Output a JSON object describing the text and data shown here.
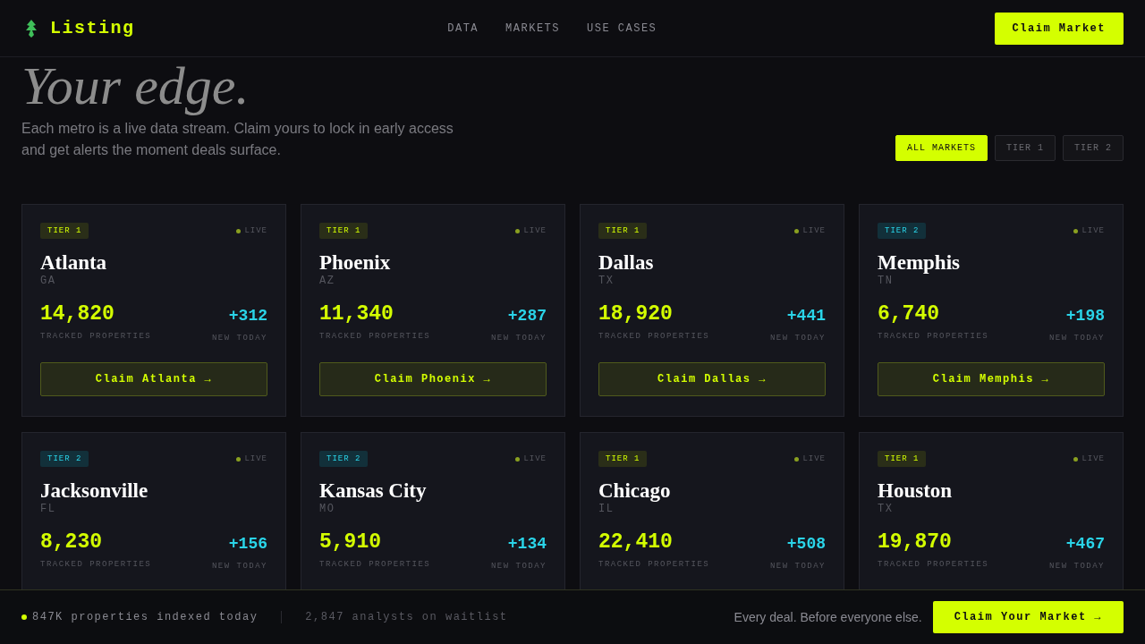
{
  "brand": {
    "name": "Listing"
  },
  "nav": [
    "DATA",
    "MARKETS",
    "USE CASES"
  ],
  "header_button": "Claim Market",
  "hero": {
    "title": "Your edge.",
    "text": "Each metro is a live data stream. Claim yours to lock in early access and get alerts the moment deals surface."
  },
  "filters": [
    {
      "label": "ALL MARKETS",
      "selected": true
    },
    {
      "label": "TIER 1",
      "selected": false
    },
    {
      "label": "TIER 2",
      "selected": false
    }
  ],
  "markets": [
    {
      "tier": "TIER 1",
      "kind": "tier1",
      "status": "LIVE",
      "city": "Atlanta",
      "state": "GA",
      "tracked": "14,820",
      "tracked_label": "TRACKED PROPERTIES",
      "new": "+312",
      "new_label": "NEW TODAY",
      "cta": "Claim Atlanta →"
    },
    {
      "tier": "TIER 1",
      "kind": "tier1",
      "status": "LIVE",
      "city": "Phoenix",
      "state": "AZ",
      "tracked": "11,340",
      "tracked_label": "TRACKED PROPERTIES",
      "new": "+287",
      "new_label": "NEW TODAY",
      "cta": "Claim Phoenix →"
    },
    {
      "tier": "TIER 1",
      "kind": "tier1",
      "status": "LIVE",
      "city": "Dallas",
      "state": "TX",
      "tracked": "18,920",
      "tracked_label": "TRACKED PROPERTIES",
      "new": "+441",
      "new_label": "NEW TODAY",
      "cta": "Claim Dallas →"
    },
    {
      "tier": "TIER 2",
      "kind": "tier2",
      "status": "LIVE",
      "city": "Memphis",
      "state": "TN",
      "tracked": "6,740",
      "tracked_label": "TRACKED PROPERTIES",
      "new": "+198",
      "new_label": "NEW TODAY",
      "cta": "Claim Memphis →"
    },
    {
      "tier": "TIER 2",
      "kind": "tier2",
      "status": "LIVE",
      "city": "Jacksonville",
      "state": "FL",
      "tracked": "8,230",
      "tracked_label": "TRACKED PROPERTIES",
      "new": "+156",
      "new_label": "NEW TODAY"
    },
    {
      "tier": "TIER 2",
      "kind": "tier2",
      "status": "LIVE",
      "city": "Kansas City",
      "state": "MO",
      "tracked": "5,910",
      "tracked_label": "TRACKED PROPERTIES",
      "new": "+134",
      "new_label": "NEW TODAY"
    },
    {
      "tier": "TIER 1",
      "kind": "tier1",
      "status": "LIVE",
      "city": "Chicago",
      "state": "IL",
      "tracked": "22,410",
      "tracked_label": "TRACKED PROPERTIES",
      "new": "+508",
      "new_label": "NEW TODAY"
    },
    {
      "tier": "TIER 1",
      "kind": "tier1",
      "status": "LIVE",
      "city": "Houston",
      "state": "TX",
      "tracked": "19,870",
      "tracked_label": "TRACKED PROPERTIES",
      "new": "+467",
      "new_label": "NEW TODAY"
    }
  ],
  "footer": {
    "indexed": "847K properties indexed today",
    "waitlist": "2,847 analysts on waitlist",
    "tagline": "Every deal. Before everyone else.",
    "button": "Claim Your Market →"
  }
}
